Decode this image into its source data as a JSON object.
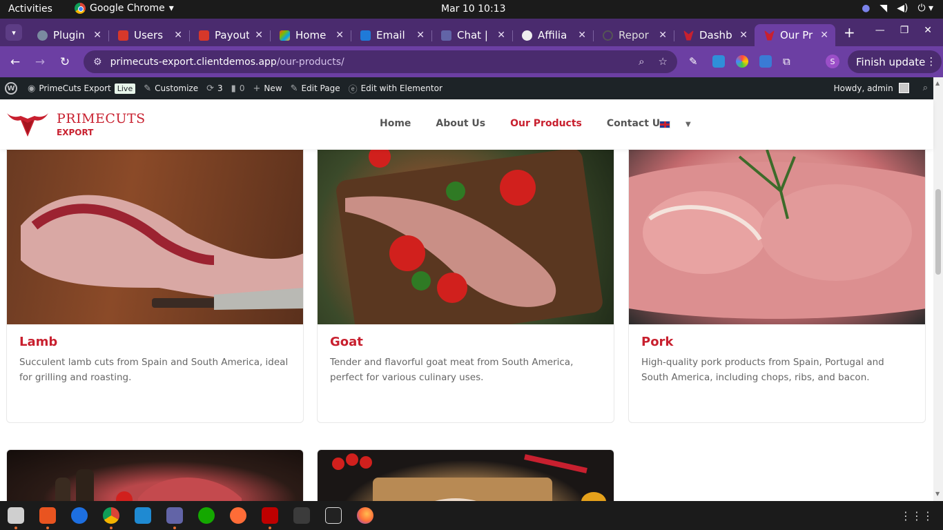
{
  "system": {
    "activities": "Activities",
    "app_name": "Google Chrome",
    "clock": "Mar 10  10:13"
  },
  "tabs": [
    {
      "label": "Plugin",
      "icon": "wordpress-favicon",
      "color": "#7a8aa0"
    },
    {
      "label": "Users",
      "icon": "red-bookmark-favicon",
      "color": "#d7382a"
    },
    {
      "label": "Payout",
      "icon": "red-bookmark-favicon",
      "color": "#d7382a"
    },
    {
      "label": "Home",
      "icon": "microsoft-favicon",
      "color": "#7a5be8"
    },
    {
      "label": "Email",
      "icon": "outlook-favicon",
      "color": "#1f7ad8"
    },
    {
      "label": "Chat |",
      "icon": "teams-favicon",
      "color": "#6264a7"
    },
    {
      "label": "Affilia",
      "icon": "openai-favicon",
      "color": "#cccccc"
    },
    {
      "label": "Repor",
      "icon": "loading-favicon",
      "color": "#555555"
    },
    {
      "label": "Dashb",
      "icon": "bull-favicon",
      "color": "#c8202f"
    },
    {
      "label": "Our Pr",
      "icon": "bull-favicon",
      "color": "#c8202f",
      "active": true
    }
  ],
  "address": {
    "domain": "primecuts-export.clientdemos.app",
    "path": "/our-products/",
    "finish_update": "Finish update",
    "profile_initial": "S"
  },
  "wpbar": {
    "site_name": "PrimeCuts Export",
    "live": "Live",
    "customize": "Customize",
    "updates_count": "3",
    "comments_count": "0",
    "new": "New",
    "edit_page": "Edit Page",
    "edit_elementor": "Edit with Elementor",
    "howdy": "Howdy, admin"
  },
  "site": {
    "logo_line1": "PRIMECUTS",
    "logo_line2": "EXPORT",
    "nav": [
      "Home",
      "About Us",
      "Our Products",
      "Contact Us"
    ],
    "active_nav": "Our Products"
  },
  "products": [
    {
      "title": "Lamb",
      "description": "Succulent lamb cuts from Spain and South America, ideal for grilling and roasting."
    },
    {
      "title": "Goat",
      "description": "Tender and flavorful goat meat from South America, perfect for various culinary uses."
    },
    {
      "title": "Pork",
      "description": "High-quality pork products from Spain, Portugal and South America, including chops, ribs, and bacon."
    }
  ],
  "colors": {
    "brand_red": "#c8202f",
    "chrome_purple": "#6c3fa3",
    "wp_bar": "#1d2327"
  }
}
